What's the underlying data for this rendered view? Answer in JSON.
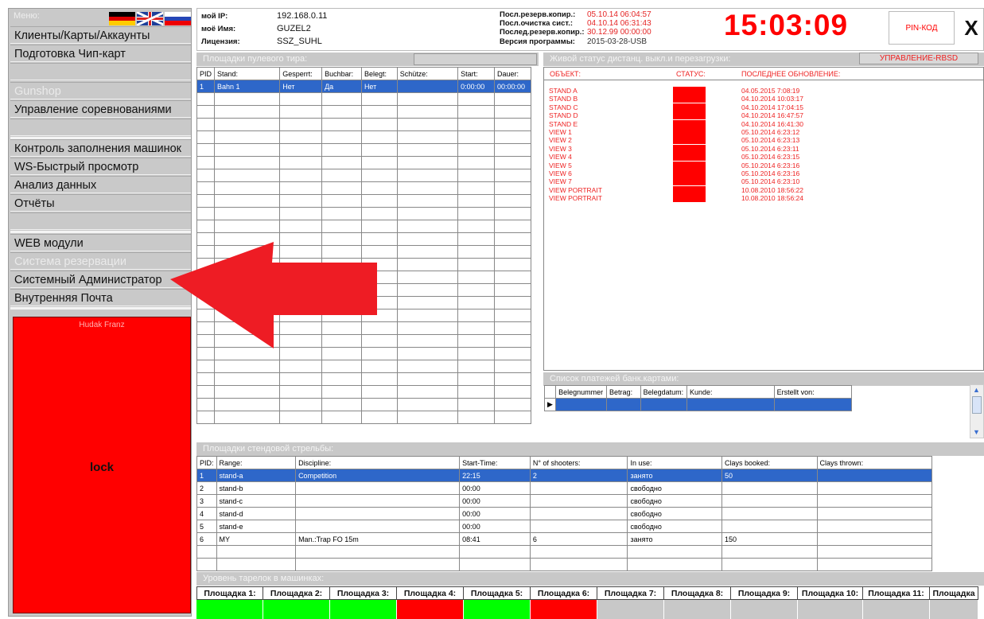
{
  "sidebar": {
    "menu_label": "Меню:",
    "items": [
      {
        "label": "Клиенты/Карты/Аккаунты",
        "disabled": false
      },
      {
        "label": "Подготовка Чип-карт",
        "disabled": false
      },
      {
        "label": "Gunshop",
        "disabled": true
      },
      {
        "label": "Управление соревнованиями",
        "disabled": false
      },
      {
        "label": "Контроль заполнения машинок",
        "disabled": false
      },
      {
        "label": "WS-Быстрый просмотр",
        "disabled": false
      },
      {
        "label": "Анализ данных",
        "disabled": false
      },
      {
        "label": "Отчёты",
        "disabled": false
      },
      {
        "label": "WEB модули",
        "disabled": false
      },
      {
        "label": "Система резервации",
        "disabled": true
      },
      {
        "label": "Системный Администратор",
        "disabled": false
      },
      {
        "label": "Внутренняя Почта",
        "disabled": false
      }
    ],
    "user_name": "Hudak Franz",
    "lock_label": "lock",
    "lock_color": "#ff0000"
  },
  "info": {
    "ip_key": "мой IP:",
    "ip_val": "192.168.0.11",
    "name_key": "моё Имя:",
    "name_val": "GUZEL2",
    "lic_key": "Лицензия:",
    "lic_val": "SSZ_SUHL",
    "backup_key": "Посл.резерв.копир.:",
    "backup_val": "05.10.14 06:04:57",
    "clean_key": "Посл.очистка сист.:",
    "clean_val": "04.10.14 06:31:43",
    "lastbackup_key": "Послед.резерв.копир.:",
    "lastbackup_val": "30.12.99 00:00:00",
    "version_key": "Версия программы:",
    "version_val": "2015-03-28-USB",
    "clock": "15:03:09",
    "pin_label": "PIN-КОД",
    "close_label": "X"
  },
  "lanes": {
    "title": "Площадки пулевого тира:",
    "headers": [
      "PID",
      "Stand:",
      "Gesperrt:",
      "Buchbar:",
      "Belegt:",
      "Schütze:",
      "Start:",
      "Dauer:"
    ],
    "rows": [
      [
        "1",
        "Bahn 1",
        "Нет",
        "Да",
        "Нет",
        "",
        "0:00:00",
        "00:00:00"
      ]
    ]
  },
  "status": {
    "title": "Живой статус дистанц. выкл.и перезагрузки:",
    "rbsd_label": "УПРАВЛЕНИЕ-RBSD",
    "col_object": "ОБЪЕКТ:",
    "col_status": "СТАТУС:",
    "col_update": "ПОСЛЕДНЕЕ ОБНОВЛЕНИЕ:",
    "rows": [
      {
        "object": "STAND A",
        "updated": "04.05.2015 7:08:19"
      },
      {
        "object": "STAND B",
        "updated": "04.10.2014 10:03:17"
      },
      {
        "object": "STAND C",
        "updated": "04.10.2014 17:04:15"
      },
      {
        "object": "STAND D",
        "updated": "04.10.2014 16:47:57"
      },
      {
        "object": "STAND E",
        "updated": "04.10.2014 16:41:30"
      },
      {
        "object": "VIEW 1",
        "updated": "05.10.2014 6:23:12"
      },
      {
        "object": "VIEW 2",
        "updated": "05.10.2014 6:23:13"
      },
      {
        "object": "VIEW 3",
        "updated": "05.10.2014 6:23:11"
      },
      {
        "object": "VIEW 4",
        "updated": "05.10.2014 6:23:15"
      },
      {
        "object": "VIEW 5",
        "updated": "05.10.2014 6:23:16"
      },
      {
        "object": "VIEW 6",
        "updated": "05.10.2014 6:23:16"
      },
      {
        "object": "VIEW 7",
        "updated": "05.10.2014 6:23:10"
      },
      {
        "object": "VIEW PORTRAIT",
        "updated": "10.08.2010 18:56:22"
      },
      {
        "object": "VIEW PORTRAIT",
        "updated": "10.08.2010 18:56:24"
      }
    ]
  },
  "payments": {
    "title": "Список платежей банк.картами:",
    "headers": [
      "Belegnummer",
      "Betrag:",
      "Belegdatum:",
      "Kunde:",
      "Erstellt von:"
    ]
  },
  "stands": {
    "title": "Площадки стендовой стрельбы:",
    "headers": [
      "PID:",
      "Range:",
      "Discipline:",
      "Start-Time:",
      "N° of shooters:",
      "In use:",
      "Clays booked:",
      "Clays thrown:"
    ],
    "rows": [
      [
        "1",
        "stand-a",
        "Competition",
        "22:15",
        "2",
        "занято",
        "50",
        ""
      ],
      [
        "2",
        "stand-b",
        "",
        "00:00",
        "",
        "свободно",
        "",
        ""
      ],
      [
        "3",
        "stand-c",
        "",
        "00:00",
        "",
        "свободно",
        "",
        ""
      ],
      [
        "4",
        "stand-d",
        "",
        "00:00",
        "",
        "свободно",
        "",
        ""
      ],
      [
        "5",
        "stand-e",
        "",
        "00:00",
        "",
        "свободно",
        "",
        ""
      ],
      [
        "6",
        "MY",
        "Man.:Trap FO 15m",
        "08:41",
        "6",
        "занято",
        "150",
        ""
      ]
    ]
  },
  "machines": {
    "title": "Уровень тарелок в машинках:",
    "slots": [
      {
        "label": "Площадка 1:",
        "color": "#00ff00"
      },
      {
        "label": "Площадка 2:",
        "color": "#00ff00"
      },
      {
        "label": "Площадка 3:",
        "color": "#00ff00"
      },
      {
        "label": "Площадка 4:",
        "color": "#ff0000"
      },
      {
        "label": "Площадка 5:",
        "color": "#00ff00"
      },
      {
        "label": "Площадка 6:",
        "color": "#ff0000"
      },
      {
        "label": "Площадка 7:",
        "color": ""
      },
      {
        "label": "Площадка 8:",
        "color": ""
      },
      {
        "label": "Площадка 9:",
        "color": ""
      },
      {
        "label": "Площадка 10:",
        "color": ""
      },
      {
        "label": "Площадка 11:",
        "color": ""
      },
      {
        "label": "Площадка",
        "color": ""
      }
    ]
  }
}
